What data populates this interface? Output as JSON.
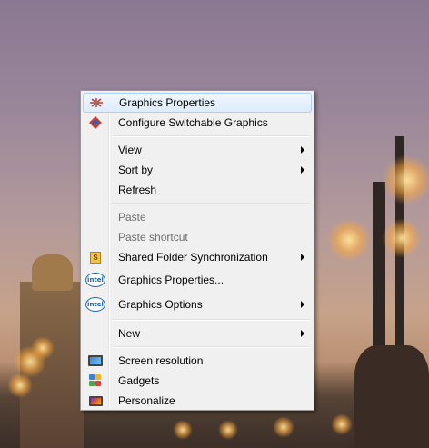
{
  "context_menu": {
    "items": [
      {
        "label": "Graphics Properties",
        "icon": "graphics-properties-icon"
      },
      {
        "label": "Configure Switchable Graphics",
        "icon": "switchable-graphics-icon"
      },
      {
        "label": "View",
        "submenu": true
      },
      {
        "label": "Sort by",
        "submenu": true
      },
      {
        "label": "Refresh"
      },
      {
        "label": "Paste",
        "disabled": true
      },
      {
        "label": "Paste shortcut",
        "disabled": true
      },
      {
        "label": "Shared Folder Synchronization",
        "icon": "shared-folder-sync-icon",
        "submenu": true
      },
      {
        "label": "Graphics Properties...",
        "icon": "intel-icon"
      },
      {
        "label": "Graphics Options",
        "icon": "intel-icon",
        "submenu": true
      },
      {
        "label": "New",
        "submenu": true
      },
      {
        "label": "Screen resolution",
        "icon": "screen-resolution-icon"
      },
      {
        "label": "Gadgets",
        "icon": "gadgets-icon"
      },
      {
        "label": "Personalize",
        "icon": "personalize-icon"
      }
    ],
    "intel_badge": "intel",
    "sfs_badge": "S"
  },
  "colors": {
    "menu_background": "#f0f0f0",
    "hover_border": "#aecff7",
    "disabled_text": "#6d6d6d"
  }
}
